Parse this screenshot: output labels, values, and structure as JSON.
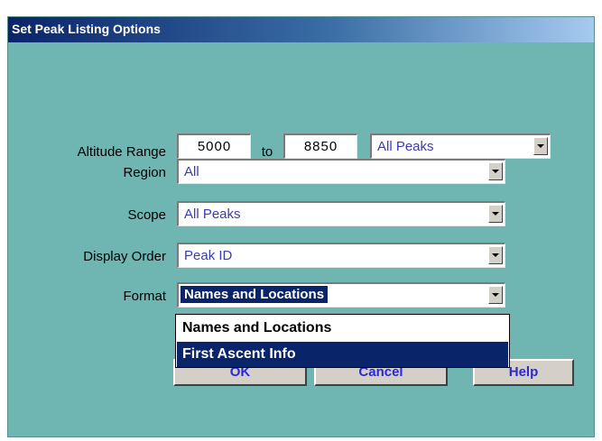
{
  "window": {
    "title": "Set Peak Listing Options"
  },
  "altitude": {
    "label": "Altitude Range",
    "from": "5000",
    "to_label": "to",
    "to": "8850",
    "filter": "All Peaks"
  },
  "region": {
    "label": "Region",
    "value": "All"
  },
  "scope": {
    "label": "Scope",
    "value": "All Peaks"
  },
  "display_order": {
    "label": "Display Order",
    "value": "Peak ID"
  },
  "format": {
    "label": "Format",
    "value": "Names and Locations",
    "options": [
      "Names and Locations",
      "First Ascent Info"
    ],
    "highlighted_option": "First Ascent Info"
  },
  "buttons": {
    "ok": "OK",
    "cancel": "Cancel",
    "help": "Help"
  },
  "colors": {
    "dialog_bg": "#6fb5b1",
    "title_bar": "#0a246a",
    "button_text": "#2a2ad0",
    "select_text": "#3a3ab0"
  }
}
